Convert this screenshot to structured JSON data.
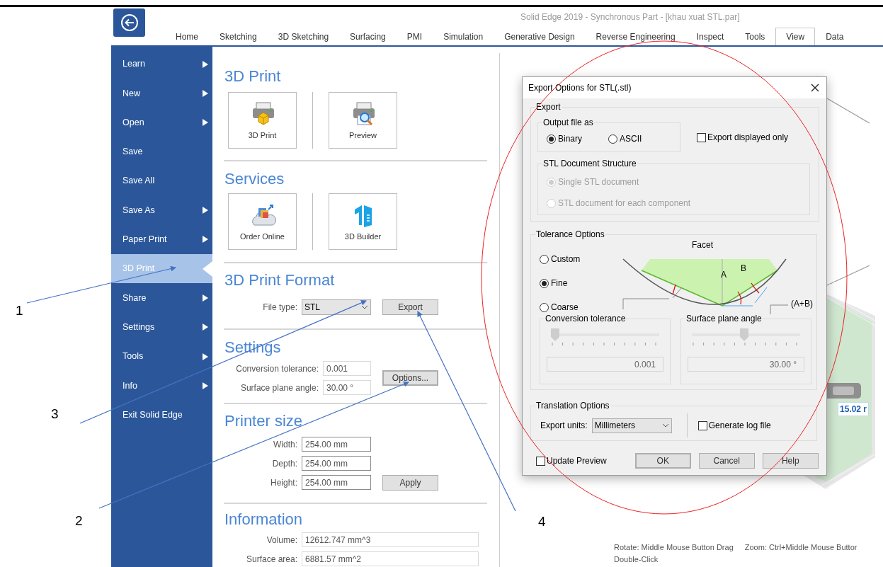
{
  "window": {
    "title": "Solid Edge 2019 - Synchronous Part - [khau xuat STL.par]"
  },
  "ribbon_tabs": [
    {
      "label": "Home",
      "selected": false
    },
    {
      "label": "Sketching",
      "selected": false
    },
    {
      "label": "3D Sketching",
      "selected": false
    },
    {
      "label": "Surfacing",
      "selected": false
    },
    {
      "label": "PMI",
      "selected": false
    },
    {
      "label": "Simulation",
      "selected": false
    },
    {
      "label": "Generative Design",
      "selected": false
    },
    {
      "label": "Reverse Engineering",
      "selected": false
    },
    {
      "label": "Inspect",
      "selected": false
    },
    {
      "label": "Tools",
      "selected": false
    },
    {
      "label": "View",
      "selected": true
    },
    {
      "label": "Data",
      "selected": false
    }
  ],
  "backstage_menu": [
    {
      "label": "Learn",
      "selected": false,
      "submenu": true
    },
    {
      "label": "New",
      "selected": false,
      "submenu": true
    },
    {
      "label": "Open",
      "selected": false,
      "submenu": true
    },
    {
      "label": "Save",
      "selected": false,
      "submenu": false
    },
    {
      "label": "Save All",
      "selected": false,
      "submenu": false
    },
    {
      "label": "Save As",
      "selected": false,
      "submenu": true
    },
    {
      "label": "Paper Print",
      "selected": false,
      "submenu": true
    },
    {
      "label": "3D Print",
      "selected": true,
      "submenu": false
    },
    {
      "label": "Share",
      "selected": false,
      "submenu": true
    },
    {
      "label": "Settings",
      "selected": false,
      "submenu": true
    },
    {
      "label": "Tools",
      "selected": false,
      "submenu": true
    },
    {
      "label": "Info",
      "selected": false,
      "submenu": true
    },
    {
      "label": "Exit Solid Edge",
      "selected": false,
      "submenu": false
    }
  ],
  "print_3d": {
    "heading": "3D Print",
    "tiles": [
      {
        "label": "3D Print",
        "kind": "printer"
      },
      {
        "label": "Preview",
        "kind": "preview"
      }
    ]
  },
  "services": {
    "heading": "Services",
    "tiles": [
      {
        "label": "Order Online",
        "kind": "cloud"
      },
      {
        "label": "3D Builder",
        "kind": "builder"
      }
    ]
  },
  "format": {
    "heading": "3D Print Format",
    "file_type_label": "File type:",
    "file_type": "STL",
    "export_button": "Export"
  },
  "settings": {
    "heading": "Settings",
    "fields": [
      {
        "label": "Conversion tolerance:",
        "value": "0.001"
      },
      {
        "label": "Surface plane angle:",
        "value": "30.00 °"
      }
    ],
    "options_button": "Options..."
  },
  "printer_size": {
    "heading": "Printer size",
    "fields": [
      {
        "label": "Width:",
        "value": "254.00 mm"
      },
      {
        "label": "Depth:",
        "value": "254.00 mm"
      },
      {
        "label": "Height:",
        "value": "254.00 mm"
      }
    ],
    "apply_button": "Apply"
  },
  "information": {
    "heading": "Information",
    "fields": [
      {
        "label": "Volume:",
        "value": "12612.747 mm^3"
      },
      {
        "label": "Surface area:",
        "value": "6881.57 mm^2"
      }
    ]
  },
  "dialog": {
    "title": "Export Options for STL(.stl)",
    "export_group": "Export",
    "output_group": "Output file as",
    "output_options": [
      {
        "label": "Binary",
        "selected": true
      },
      {
        "label": "ASCII",
        "selected": false
      }
    ],
    "export_displayed_only": {
      "label": "Export displayed only",
      "checked": false
    },
    "structure_group": "STL Document Structure",
    "structure_options": [
      {
        "label": "Single STL document",
        "selected": true,
        "disabled": true
      },
      {
        "label": "STL document for each component",
        "selected": false,
        "disabled": true
      }
    ],
    "tolerance_group": "Tolerance Options",
    "tolerance_options": [
      {
        "label": "Custom",
        "selected": false
      },
      {
        "label": "Fine",
        "selected": true
      },
      {
        "label": "Coarse",
        "selected": false
      }
    ],
    "facet_title": "Facet",
    "facet_marks": [
      "A",
      "B"
    ],
    "facet_sum": "(A+B)",
    "sliders": [
      {
        "label": "Conversion tolerance",
        "level": 0.0,
        "value": "0.001"
      },
      {
        "label": "Surface plane angle",
        "level": 0.48,
        "value": "30.00 °"
      }
    ],
    "translation_group": "Translation Options",
    "units_label": "Export units:",
    "units": "Millimeters",
    "generate_log": {
      "label": "Generate log file",
      "checked": false
    },
    "update_preview": {
      "label": "Update Preview",
      "checked": false
    },
    "buttons": [
      {
        "label": "OK",
        "default": true
      },
      {
        "label": "Cancel",
        "default": false
      },
      {
        "label": "Help",
        "default": false
      }
    ]
  },
  "viewport": {
    "dimension": "15.02 r",
    "hints": [
      "Rotate: Middle Mouse Button Drag",
      "Zoom: Ctrl+Middle Mouse Buttor",
      "Double-Click"
    ]
  },
  "annotations": [
    "1",
    "3",
    "2",
    "4"
  ]
}
